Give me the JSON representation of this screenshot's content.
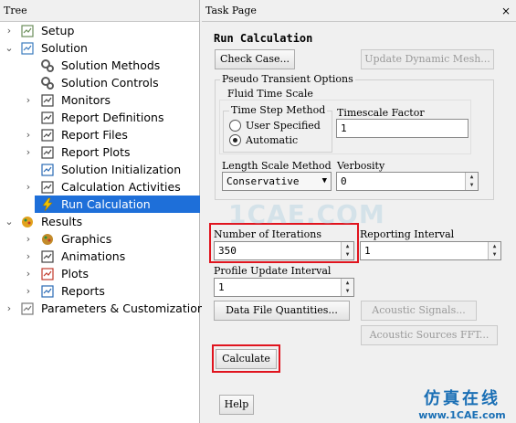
{
  "tree": {
    "header": "Tree",
    "items": [
      {
        "label": "Setup",
        "icon": "setup-icon",
        "arrow": "›"
      },
      {
        "label": "Solution",
        "icon": "solution-icon",
        "arrow": "⌄"
      },
      {
        "label": "Solution Methods",
        "icon": "gears-icon",
        "arrow": ""
      },
      {
        "label": "Solution Controls",
        "icon": "gears-icon",
        "arrow": ""
      },
      {
        "label": "Monitors",
        "icon": "monitor-icon",
        "arrow": "›"
      },
      {
        "label": "Report Definitions",
        "icon": "report-definitions-icon",
        "arrow": ""
      },
      {
        "label": "Report Files",
        "icon": "report-files-icon",
        "arrow": "›"
      },
      {
        "label": "Report Plots",
        "icon": "report-plots-icon",
        "arrow": "›"
      },
      {
        "label": "Solution Initialization",
        "icon": "initialization-icon",
        "arrow": ""
      },
      {
        "label": "Calculation Activities",
        "icon": "calculation-activities-icon",
        "arrow": "›"
      },
      {
        "label": "Run Calculation",
        "icon": "lightning-icon",
        "arrow": ""
      },
      {
        "label": "Results",
        "icon": "results-icon",
        "arrow": "⌄"
      },
      {
        "label": "Graphics",
        "icon": "graphics-icon",
        "arrow": "›"
      },
      {
        "label": "Animations",
        "icon": "animations-icon",
        "arrow": "›"
      },
      {
        "label": "Plots",
        "icon": "plots-icon",
        "arrow": "›"
      },
      {
        "label": "Reports",
        "icon": "reports-icon",
        "arrow": "›"
      },
      {
        "label": "Parameters & Customization",
        "icon": "parameters-icon",
        "arrow": "›"
      }
    ]
  },
  "task": {
    "header": "Task Page",
    "close": "×",
    "title": "Run Calculation",
    "check_case": "Check Case...",
    "update_dynamic_mesh": "Update Dynamic Mesh...",
    "pseudo_group": "Pseudo Transient Options",
    "fluid_time_scale": "Fluid Time Scale",
    "time_step_method": "Time Step Method",
    "user_specified": "User Specified",
    "automatic": "Automatic",
    "timescale_factor_label": "Timescale Factor",
    "timescale_factor_value": "1",
    "length_scale_method_label": "Length Scale Method",
    "length_scale_method_value": "Conservative",
    "verbosity_label": "Verbosity",
    "verbosity_value": "0",
    "iterations_label": "Number of Iterations",
    "iterations_value": "350",
    "reporting_interval_label": "Reporting Interval",
    "reporting_interval_value": "1",
    "profile_update_label": "Profile Update Interval",
    "profile_update_value": "1",
    "data_file_quantities": "Data File Quantities...",
    "acoustic_signals": "Acoustic Signals...",
    "acoustic_sources_fft": "Acoustic Sources FFT...",
    "calculate": "Calculate",
    "help": "Help"
  },
  "watermark": "1CAE.COM",
  "brand": {
    "cn": "仿真在线",
    "en": "www.1CAE.com"
  },
  "colors": {
    "selection": "#1e6fd9",
    "highlight": "#e0141e",
    "brand": "#1a6fb5"
  }
}
